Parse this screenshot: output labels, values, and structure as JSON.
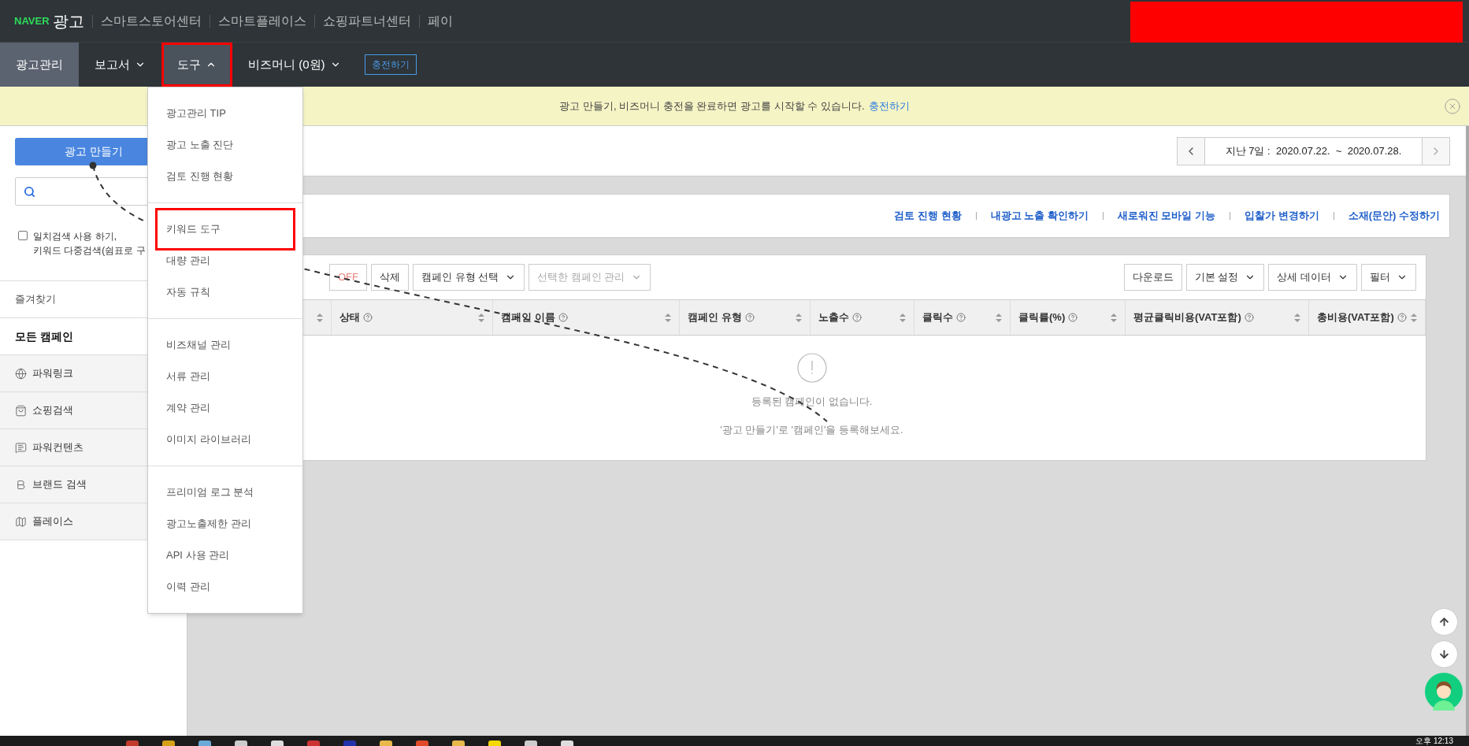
{
  "header": {
    "logo_brand": "NAVER",
    "logo_service": "광고",
    "links": [
      "스마트스토어센터",
      "스마트플레이스",
      "쇼핑파트너센터",
      "페이"
    ]
  },
  "nav": {
    "items": [
      {
        "label": "광고관리",
        "selected": true,
        "highlighted": false
      },
      {
        "label": "보고서",
        "selected": false,
        "expanded": false,
        "highlighted": false
      },
      {
        "label": "도구",
        "selected": false,
        "expanded": true,
        "highlighted": true
      },
      {
        "label": "비즈머니 (0원)",
        "selected": false,
        "expanded": false,
        "highlighted": false
      }
    ],
    "charge_button": "충전하기"
  },
  "notice": {
    "text": "광고 만들기, 비즈머니 충전을 완료하면 광고를 시작할 수 있습니다.",
    "link": "충전하기"
  },
  "sidebar": {
    "create_button": "광고 만들기",
    "exact_search": {
      "checked": false,
      "lines": [
        "일치검색 사용 하기,",
        "키워드 다중검색(쉼표로 구"
      ]
    },
    "favorites": "즐겨찾기",
    "all_campaigns": "모든 캠페인",
    "campaign_types": [
      {
        "label": "파워링크"
      },
      {
        "label": "쇼핑검색"
      },
      {
        "label": "파워컨텐츠"
      },
      {
        "label": "브랜드 검색"
      },
      {
        "label": "플레이스"
      }
    ]
  },
  "tools_menu": {
    "groups": [
      [
        {
          "label": "광고관리 TIP",
          "highlighted": false
        },
        {
          "label": "광고 노출 진단",
          "highlighted": false
        },
        {
          "label": "검토 진행 현황",
          "highlighted": false
        }
      ],
      [
        {
          "label": "키워드 도구",
          "highlighted": true
        },
        {
          "label": "대량 관리",
          "highlighted": false
        },
        {
          "label": "자동 규칙",
          "highlighted": false
        }
      ],
      [
        {
          "label": "비즈채널 관리",
          "highlighted": false
        },
        {
          "label": "서류 관리",
          "highlighted": false
        },
        {
          "label": "계약 관리",
          "highlighted": false
        },
        {
          "label": "이미지 라이브러리",
          "highlighted": false
        }
      ],
      [
        {
          "label": "프리미엄 로그 분석",
          "highlighted": false
        },
        {
          "label": "광고노출제한 관리",
          "highlighted": false
        },
        {
          "label": "API 사용 관리",
          "highlighted": false
        },
        {
          "label": "이력 관리",
          "highlighted": false
        }
      ]
    ]
  },
  "date_range": {
    "label": "지난 7일 :  2020.07.22.  ~  2020.07.28."
  },
  "quick_links": [
    "검토 진행 현황",
    "내광고 노출 확인하기",
    "새로워진 모바일 기능",
    "입찰가 변경하기",
    "소재(문안) 수정하기"
  ],
  "campaign_table": {
    "toolbar_left": [
      {
        "label": "OFF",
        "kind": "off",
        "disabled": false
      },
      {
        "label": "삭제",
        "kind": "plain",
        "disabled": false
      },
      {
        "label": "캠페인 유형 선택",
        "kind": "dropdown",
        "disabled": false
      },
      {
        "label": "선택한 캠페인 관리",
        "kind": "dropdown",
        "disabled": true
      }
    ],
    "toolbar_right": [
      {
        "label": "다운로드",
        "kind": "plain",
        "disabled": false
      },
      {
        "label": "기본 설정",
        "kind": "dropdown",
        "disabled": false
      },
      {
        "label": "상세 데이터",
        "kind": "dropdown",
        "disabled": false
      },
      {
        "label": "필터",
        "kind": "dropdown",
        "disabled": false
      }
    ],
    "columns": [
      "상태",
      "캠페인 이름",
      "캠페인 유형",
      "노출수",
      "클릭수",
      "클릭률(%)",
      "평균클릭비용(VAT포함)",
      "총비용(VAT포함)"
    ],
    "empty_title": "등록된 캠페인이 없습니다.",
    "empty_hint": "'광고 만들기'로 '캠페인'을 등록해보세요."
  },
  "taskbar": {
    "time": "오후 12:13"
  }
}
